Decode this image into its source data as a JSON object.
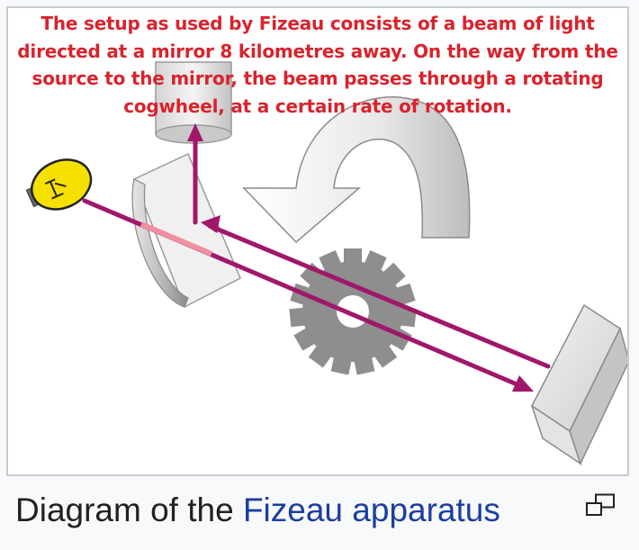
{
  "diagram": {
    "overlay_text": "The setup as used by Fizeau consists of a beam of light directed at a mirror 8 kilometres away. On the way from the source to the mirror, the beam passes through a rotating cogwheel, at a certain rate of rotation.",
    "colors": {
      "beam": "#a0176b",
      "overlay_text": "#d9232d",
      "bulb": "#f5e000",
      "mirror_gray": "#c8c8c8",
      "cogwheel": "#8e8e8e"
    }
  },
  "caption": {
    "prefix": "Diagram of the ",
    "link": "Fizeau apparatus",
    "enlarge_icon": "enlarge-icon"
  }
}
